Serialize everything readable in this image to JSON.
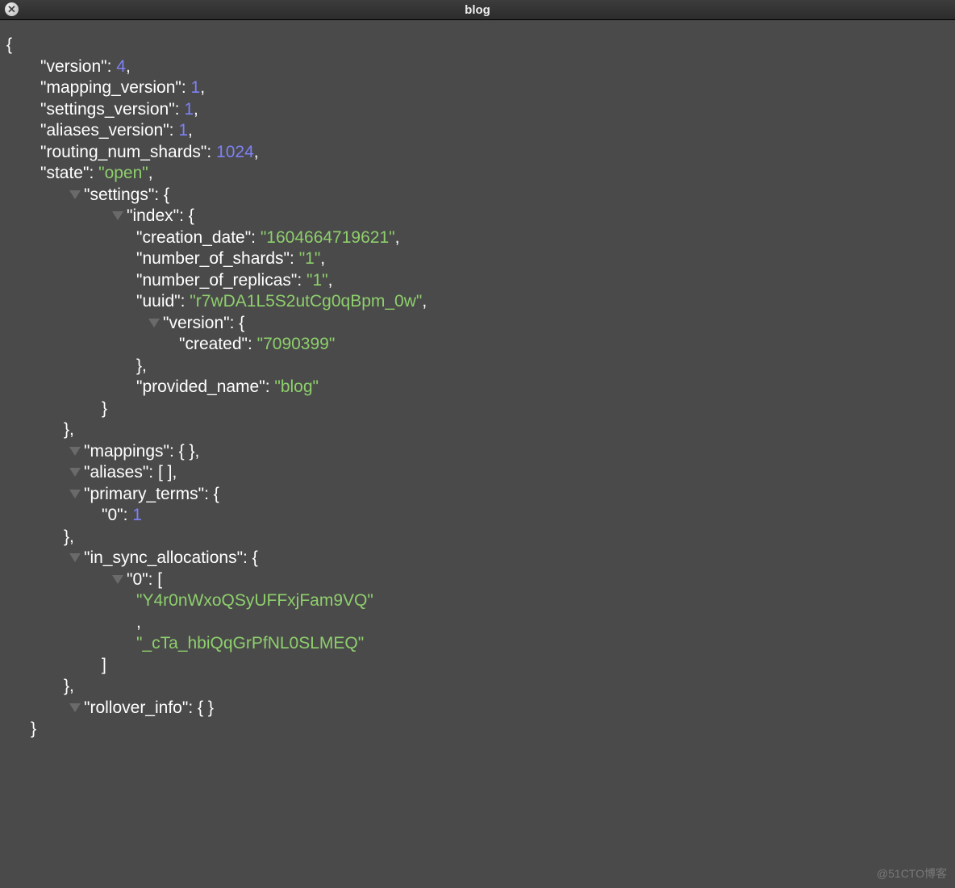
{
  "window": {
    "title": "blog"
  },
  "json": {
    "version_key": "\"version\"",
    "version_val": "4",
    "mapping_version_key": "\"mapping_version\"",
    "mapping_version_val": "1",
    "settings_version_key": "\"settings_version\"",
    "settings_version_val": "1",
    "aliases_version_key": "\"aliases_version\"",
    "aliases_version_val": "1",
    "routing_num_shards_key": "\"routing_num_shards\"",
    "routing_num_shards_val": "1024",
    "state_key": "\"state\"",
    "state_val": "\"open\"",
    "settings_key": "\"settings\"",
    "index_key": "\"index\"",
    "creation_date_key": "\"creation_date\"",
    "creation_date_val": "\"1604664719621\"",
    "number_of_shards_key": "\"number_of_shards\"",
    "number_of_shards_val": "\"1\"",
    "number_of_replicas_key": "\"number_of_replicas\"",
    "number_of_replicas_val": "\"1\"",
    "uuid_key": "\"uuid\"",
    "uuid_val": "\"r7wDA1L5S2utCg0qBpm_0w\"",
    "ver_key": "\"version\"",
    "created_key": "\"created\"",
    "created_val": "\"7090399\"",
    "provided_name_key": "\"provided_name\"",
    "provided_name_val": "\"blog\"",
    "mappings_key": "\"mappings\"",
    "aliases_key": "\"aliases\"",
    "primary_terms_key": "\"primary_terms\"",
    "pt_0_key": "\"0\"",
    "pt_0_val": "1",
    "in_sync_key": "\"in_sync_allocations\"",
    "isa_0_key": "\"0\"",
    "isa_v0": "\"Y4r0nWxoQSyUFFxjFam9VQ\"",
    "isa_v1": "\"_cTa_hbiQqGrPfNL0SLMEQ\"",
    "rollover_key": "\"rollover_info\""
  },
  "watermark": "@51CTO博客"
}
